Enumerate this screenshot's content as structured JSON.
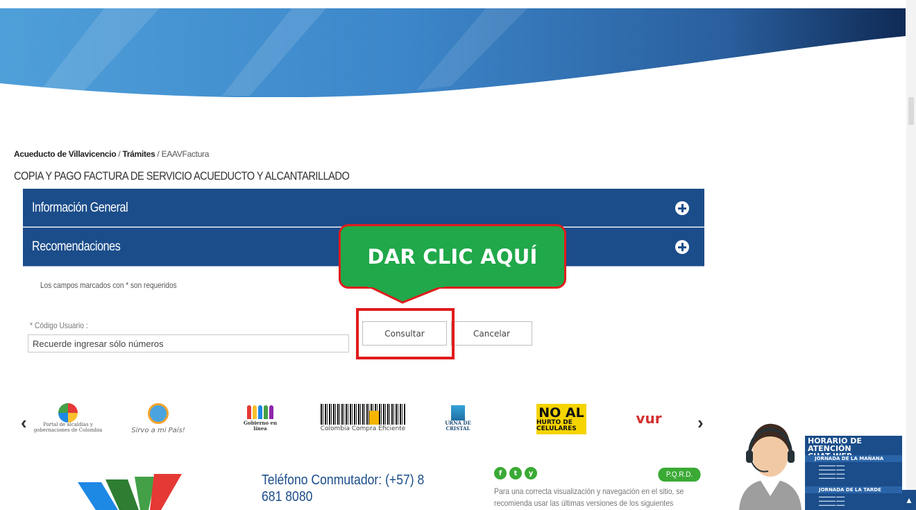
{
  "breadcrumb": {
    "home": "Acueducto de Villavicencio",
    "separator": "/",
    "section": "Trámites",
    "current": "EAAVFactura"
  },
  "page": {
    "title": "COPIA Y PAGO FACTURA DE SERVICIO ACUEDUCTO Y ALCANTARILLADO"
  },
  "accordion": [
    {
      "label": "Información General"
    },
    {
      "label": "Recomendaciones"
    }
  ],
  "callout": {
    "text": "DAR CLIC AQUÍ",
    "colors": {
      "fill": "#20a84a",
      "border": "#e01c1c"
    }
  },
  "form": {
    "required_note": "Los campos marcados con * son requeridos",
    "user_code_label": "* Código Usuario :",
    "user_code_placeholder": "Recuerde ingresar sólo números",
    "submit_label": "Consultar",
    "cancel_label": "Cancelar"
  },
  "logos": [
    {
      "name": "gobernaciones-logo",
      "caption": "Portal de alcaldías y gobernaciones de Colombia"
    },
    {
      "name": "servir-logo",
      "caption": "Sirvo a mi País!"
    },
    {
      "name": "gobierno-linea-logo",
      "caption": "Gobierno en línea"
    },
    {
      "name": "colombia-compra-logo",
      "caption": "Colombia Compra Eficiente"
    },
    {
      "name": "urna-logo",
      "caption": "URNA DE CRISTAL"
    },
    {
      "name": "noal-logo",
      "line1": "NO AL",
      "line2": "HURTO DE CELULARES"
    },
    {
      "name": "vur-logo",
      "text": "vur"
    }
  ],
  "footer": {
    "phone": "Teléfono Conmutador: (+57) 8 681 8080",
    "social": [
      "f",
      "t",
      "y"
    ],
    "pqrd_label": "P.Q.R.D.",
    "browser_note": "Para una correcta visualización y navegación en el sitio, se recomienda usar las últimas versiones de los siguientes"
  },
  "chat": {
    "title_line1": "HORARIO DE ATENCIÓN",
    "title_line2": "CHAT WEB",
    "morning": "JORNADA DE LA MAÑANA",
    "afternoon": "JORNADA DE LA TARDE"
  },
  "colors": {
    "primary_blue": "#1b4d8a",
    "green": "#3aaa35",
    "highlight_red": "#e01c1c"
  }
}
